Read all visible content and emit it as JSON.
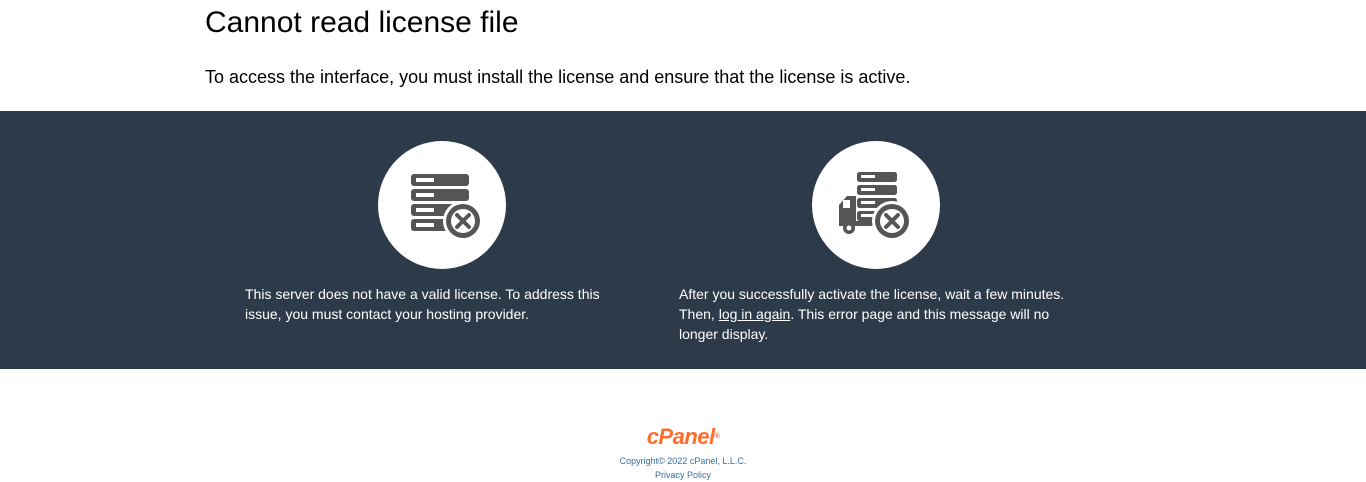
{
  "header": {
    "title": "Cannot read license file",
    "subtitle": "To access the interface, you must install the license and ensure that the license is active."
  },
  "band": {
    "background_color": "#2c3a4a",
    "left_block": {
      "icon": "server-stack-error-icon",
      "text": "This server does not have a valid license. To address this issue, you must contact your hosting provider."
    },
    "right_block": {
      "icon": "server-truck-error-icon",
      "text_before_link": "After you successfully activate the license, wait a few minutes. Then, ",
      "link_label": "log in again",
      "text_after_link": ". This error page and this message will no longer display."
    }
  },
  "footer": {
    "logo_text": "cPanel",
    "logo_mark": "®",
    "logo_color": "#ff6c2c",
    "copyright": "Copyright© 2022 cPanel, L.L.C.",
    "privacy_label": "Privacy Policy",
    "link_color": "#2f6fa8"
  }
}
